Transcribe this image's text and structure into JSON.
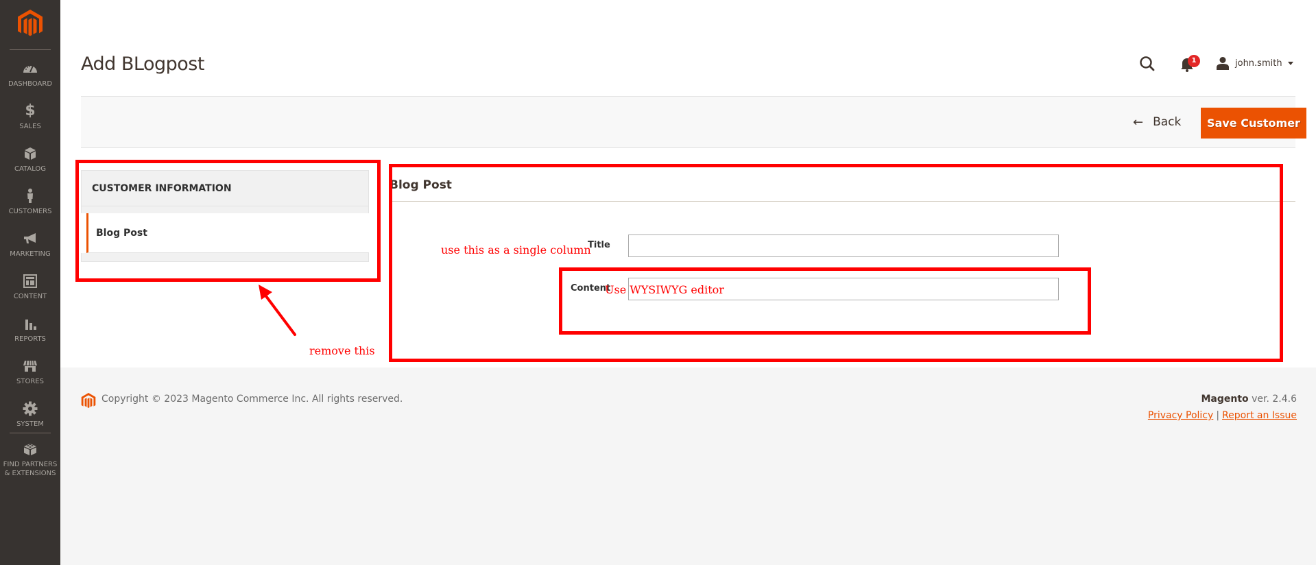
{
  "sidebar": {
    "logo": "magento-logo",
    "items": [
      {
        "label": "DASHBOARD",
        "icon": "dashboard-icon"
      },
      {
        "label": "SALES",
        "icon": "dollar-icon"
      },
      {
        "label": "CATALOG",
        "icon": "box-icon"
      },
      {
        "label": "CUSTOMERS",
        "icon": "person-icon"
      },
      {
        "label": "MARKETING",
        "icon": "megaphone-icon"
      },
      {
        "label": "CONTENT",
        "icon": "layout-icon"
      },
      {
        "label": "REPORTS",
        "icon": "bar-chart-icon"
      },
      {
        "label": "STORES",
        "icon": "storefront-icon"
      },
      {
        "label": "SYSTEM",
        "icon": "gear-icon"
      },
      {
        "label": "FIND PARTNERS & EXTENSIONS",
        "label_line1": "FIND PARTNERS",
        "label_line2": "& EXTENSIONS",
        "icon": "lego-brick-icon"
      }
    ]
  },
  "header": {
    "title": "Add BLogpost",
    "notifications_count": "1",
    "username": "john.smith"
  },
  "toolbar": {
    "back_label": "Back",
    "save_label": "Save Customer"
  },
  "tabs": {
    "title": "CUSTOMER INFORMATION",
    "items": [
      {
        "label": "Blog Post",
        "active": true
      }
    ]
  },
  "form": {
    "section_title": "Blog Post",
    "fields": [
      {
        "label": "Title",
        "value": ""
      },
      {
        "label": "Content",
        "value": ""
      }
    ]
  },
  "annotations": {
    "single_column_note": "use this as a single column",
    "wysiwyg_note": "Use WYSIWYG editor",
    "remove_note": "remove this",
    "color": "#ff0000"
  },
  "footer": {
    "copyright": "Copyright © 2023 Magento Commerce Inc. All rights reserved.",
    "brand": "Magento",
    "version": " ver. 2.4.6",
    "privacy_label": "Privacy Policy",
    "separator": "|",
    "report_label": "Report an Issue"
  },
  "colors": {
    "accent": "#eb5202",
    "sidebar_bg": "#373330",
    "badge": "#e22626"
  }
}
